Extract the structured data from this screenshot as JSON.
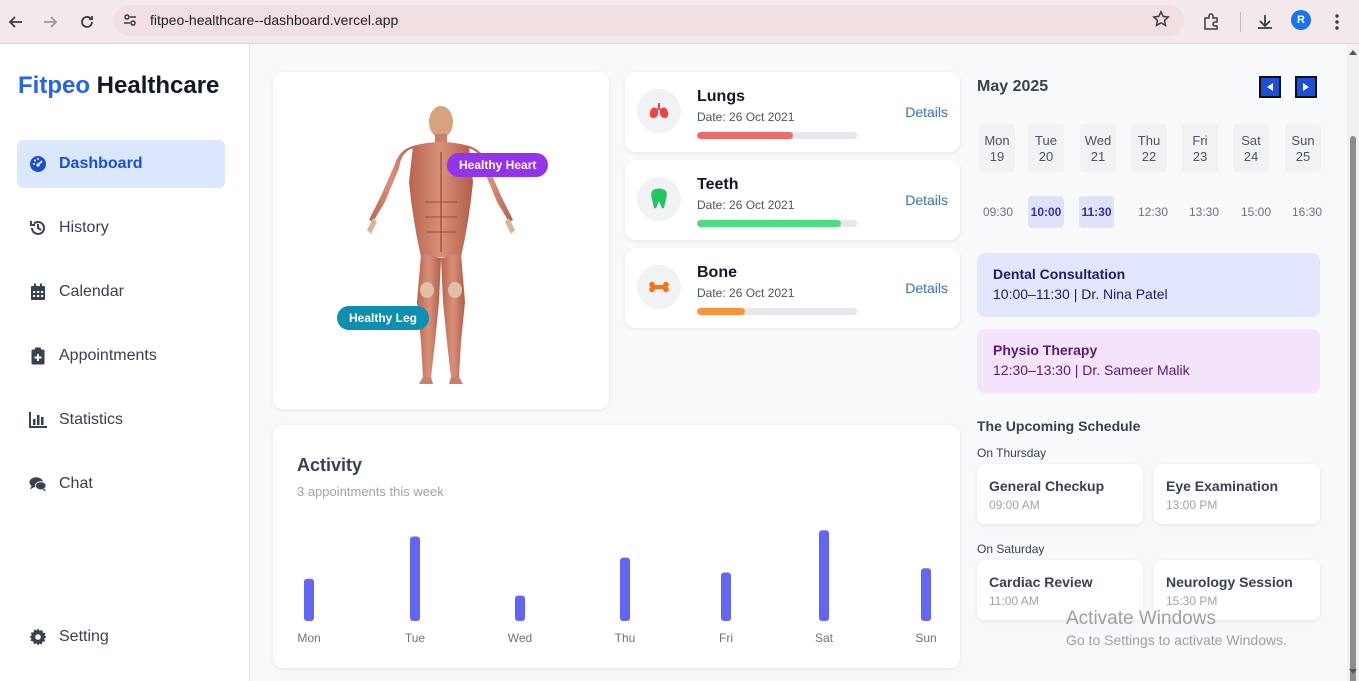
{
  "browser": {
    "url": "fitpeo-healthcare--dashboard.vercel.app",
    "profile_initial": "R"
  },
  "sidebar": {
    "brand_part1": "Fitpeo",
    "brand_part2": "Healthcare",
    "items": [
      {
        "label": "Dashboard",
        "icon": "dashboard-gauge-icon",
        "active": true
      },
      {
        "label": "History",
        "icon": "history-icon"
      },
      {
        "label": "Calendar",
        "icon": "calendar-icon"
      },
      {
        "label": "Appointments",
        "icon": "appointments-clipboard-icon"
      },
      {
        "label": "Statistics",
        "icon": "statistics-chart-icon"
      },
      {
        "label": "Chat",
        "icon": "chat-bubbles-icon"
      }
    ],
    "setting_label": "Setting"
  },
  "anatomy": {
    "tag_heart": "Healthy Heart",
    "tag_leg": "Healthy Leg",
    "heart_color": "#9333ea",
    "leg_color": "#0e8fb0"
  },
  "organs": [
    {
      "name": "Lungs",
      "date": "Date: 26 Oct 2021",
      "details": "Details",
      "progress": 0.6,
      "color": "#ef6b6b",
      "icon": "lungs-icon"
    },
    {
      "name": "Teeth",
      "date": "Date: 26 Oct 2021",
      "details": "Details",
      "progress": 0.9,
      "color": "#4ade80",
      "icon": "tooth-icon"
    },
    {
      "name": "Bone",
      "date": "Date: 26 Oct 2021",
      "details": "Details",
      "progress": 0.3,
      "color": "#fb923c",
      "icon": "bone-icon"
    }
  ],
  "activity": {
    "title": "Activity",
    "subtitle": "3 appointments this week"
  },
  "chart_data": {
    "type": "bar",
    "categories": [
      "Mon",
      "Tue",
      "Wed",
      "Thu",
      "Fri",
      "Sat",
      "Sun"
    ],
    "values": [
      2,
      4,
      1.2,
      3,
      2.3,
      4.3,
      2.5
    ],
    "ylim": [
      0,
      4.5
    ],
    "color": "#6366f1",
    "grid": false
  },
  "calendar": {
    "month": "May 2025",
    "days": [
      {
        "name": "Mon",
        "num": "19"
      },
      {
        "name": "Tue",
        "num": "20"
      },
      {
        "name": "Wed",
        "num": "21"
      },
      {
        "name": "Thu",
        "num": "22"
      },
      {
        "name": "Fri",
        "num": "23"
      },
      {
        "name": "Sat",
        "num": "24"
      },
      {
        "name": "Sun",
        "num": "25"
      }
    ],
    "times": [
      "09:30",
      "10:00",
      "11:30",
      "12:30",
      "13:30",
      "15:00",
      "16:30"
    ],
    "highlighted_times": [
      "10:00",
      "11:30"
    ]
  },
  "appointments": [
    {
      "title": "Dental Consultation",
      "subtitle": "10:00–11:30 | Dr. Nina Patel",
      "bg": "#e0e7ff",
      "color": "#1e1b6b"
    },
    {
      "title": "Physio Therapy",
      "subtitle": "12:30–13:30 | Dr. Sameer Malik",
      "bg": "#f3e3fb",
      "color": "#5b1a7a"
    }
  ],
  "upcoming": {
    "title": "The Upcoming Schedule",
    "groups": [
      {
        "day": "On Thursday",
        "items": [
          {
            "title": "General Checkup",
            "time": "09:00 AM"
          },
          {
            "title": "Eye Examination",
            "time": "13:00 PM"
          }
        ]
      },
      {
        "day": "On Saturday",
        "items": [
          {
            "title": "Cardiac Review",
            "time": "11:00 AM"
          },
          {
            "title": "Neurology Session",
            "time": "15:30 PM"
          }
        ]
      }
    ]
  },
  "watermark": {
    "line1": "Activate Windows",
    "line2": "Go to Settings to activate Windows."
  }
}
